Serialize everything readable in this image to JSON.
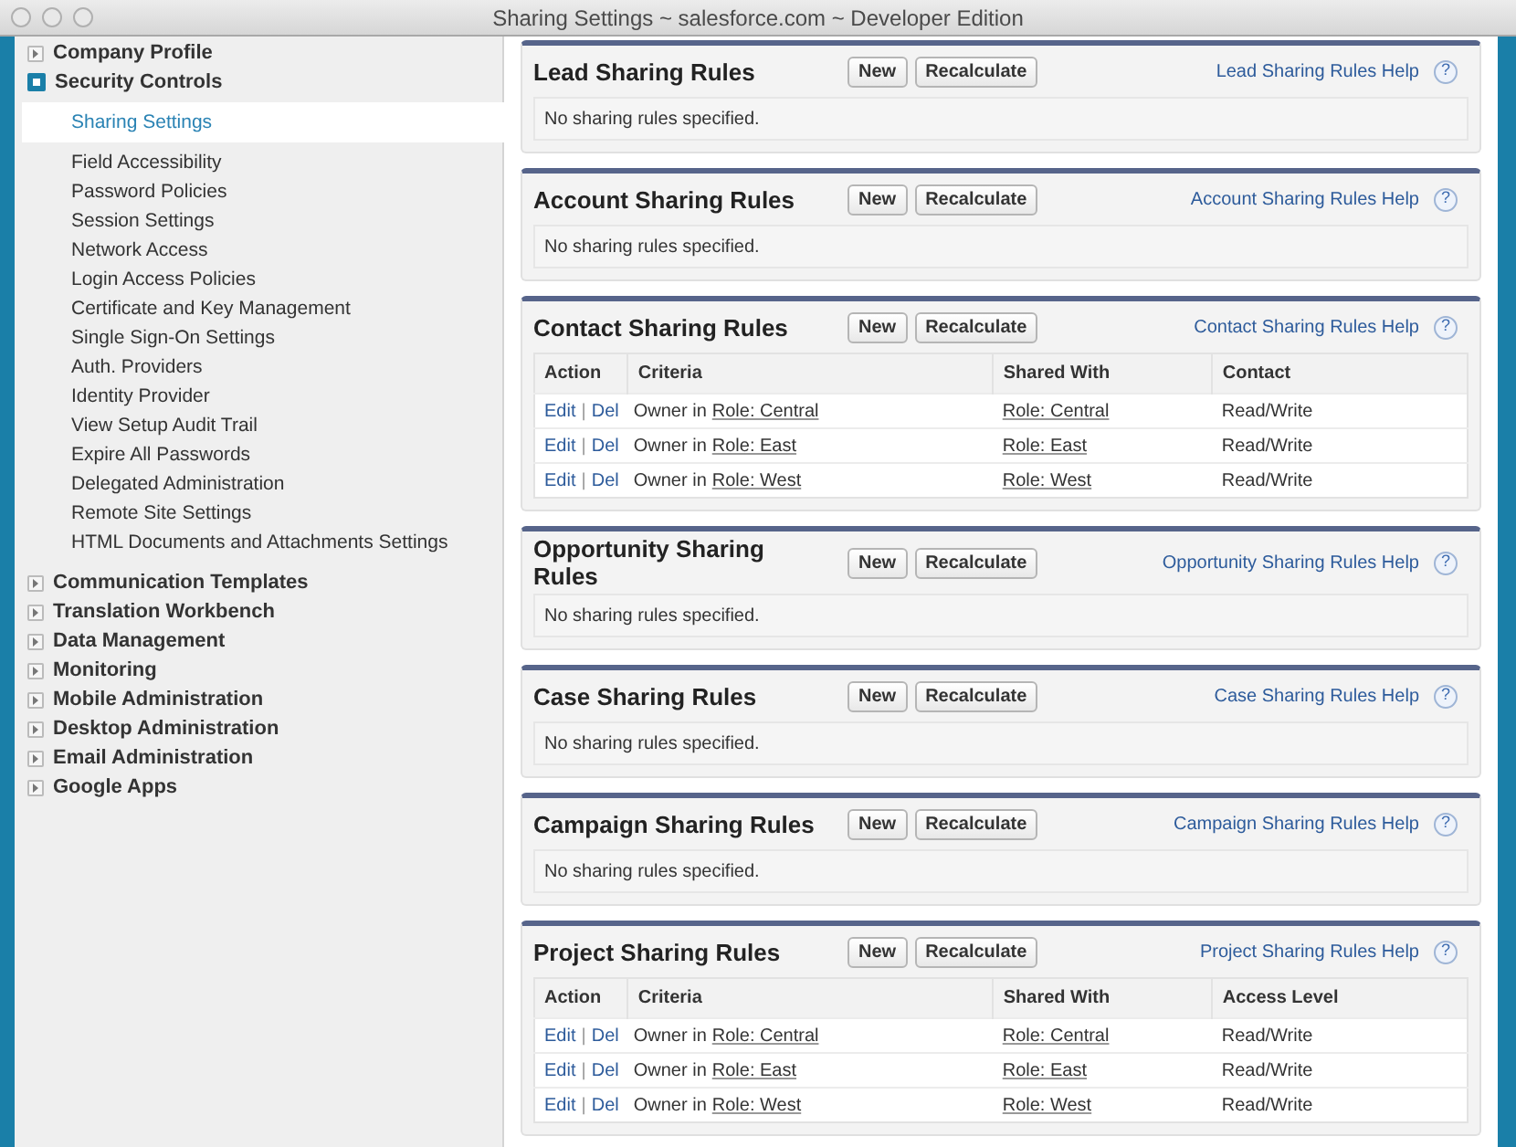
{
  "window": {
    "title": "Sharing Settings ~ salesforce.com ~ Developer Edition"
  },
  "sidebar": {
    "groups": [
      {
        "label": "Company Profile",
        "expanded": false
      },
      {
        "label": "Security Controls",
        "expanded": true,
        "children": [
          {
            "label": "Sharing Settings",
            "selected": true
          },
          {
            "label": "Field Accessibility",
            "selected": false
          },
          {
            "label": "Password Policies",
            "selected": false
          },
          {
            "label": "Session Settings",
            "selected": false
          },
          {
            "label": "Network Access",
            "selected": false
          },
          {
            "label": "Login Access Policies",
            "selected": false
          },
          {
            "label": "Certificate and Key Management",
            "selected": false
          },
          {
            "label": "Single Sign-On Settings",
            "selected": false
          },
          {
            "label": "Auth. Providers",
            "selected": false
          },
          {
            "label": "Identity Provider",
            "selected": false
          },
          {
            "label": "View Setup Audit Trail",
            "selected": false
          },
          {
            "label": "Expire All Passwords",
            "selected": false
          },
          {
            "label": "Delegated Administration",
            "selected": false
          },
          {
            "label": "Remote Site Settings",
            "selected": false
          },
          {
            "label": "HTML Documents and Attachments Settings",
            "selected": false
          }
        ]
      },
      {
        "label": "Communication Templates",
        "expanded": false
      },
      {
        "label": "Translation Workbench",
        "expanded": false
      },
      {
        "label": "Data Management",
        "expanded": false
      },
      {
        "label": "Monitoring",
        "expanded": false
      },
      {
        "label": "Mobile Administration",
        "expanded": false
      },
      {
        "label": "Desktop Administration",
        "expanded": false
      },
      {
        "label": "Email Administration",
        "expanded": false
      },
      {
        "label": "Google Apps",
        "expanded": false
      }
    ]
  },
  "sections": [
    {
      "title": "Lead Sharing Rules",
      "buttons": [
        "New",
        "Recalculate"
      ],
      "help": "Lead Sharing Rules Help",
      "help_icon": "?",
      "empty": "No sharing rules specified."
    },
    {
      "title": "Account Sharing Rules",
      "buttons": [
        "New",
        "Recalculate"
      ],
      "help": "Account Sharing Rules Help",
      "help_icon": "?",
      "empty": "No sharing rules specified."
    },
    {
      "title": "Contact Sharing Rules",
      "buttons": [
        "New",
        "Recalculate"
      ],
      "help": "Contact Sharing Rules Help",
      "help_icon": "?",
      "table": {
        "columns": [
          "Action",
          "Criteria",
          "Shared With",
          "Contact"
        ],
        "rows": [
          {
            "edit": "Edit",
            "separator": "|",
            "del": "Del",
            "criteria_prefix": "Owner in",
            "criteria_role": "Role: Central",
            "shared_with": "Role: Central",
            "access": "Read/Write"
          },
          {
            "edit": "Edit",
            "separator": "|",
            "del": "Del",
            "criteria_prefix": "Owner in",
            "criteria_role": "Role: East",
            "shared_with": "Role: East",
            "access": "Read/Write"
          },
          {
            "edit": "Edit",
            "separator": "|",
            "del": "Del",
            "criteria_prefix": "Owner in",
            "criteria_role": "Role: West",
            "shared_with": "Role: West",
            "access": "Read/Write"
          }
        ]
      }
    },
    {
      "title": "Opportunity Sharing Rules",
      "buttons": [
        "New",
        "Recalculate"
      ],
      "help": "Opportunity Sharing Rules Help",
      "help_icon": "?",
      "empty": "No sharing rules specified."
    },
    {
      "title": "Case Sharing Rules",
      "buttons": [
        "New",
        "Recalculate"
      ],
      "help": "Case Sharing Rules Help",
      "help_icon": "?",
      "empty": "No sharing rules specified."
    },
    {
      "title": "Campaign Sharing Rules",
      "buttons": [
        "New",
        "Recalculate"
      ],
      "help": "Campaign Sharing Rules Help",
      "help_icon": "?",
      "empty": "No sharing rules specified."
    },
    {
      "title": "Project Sharing Rules",
      "buttons": [
        "New",
        "Recalculate"
      ],
      "help": "Project Sharing Rules Help",
      "help_icon": "?",
      "table": {
        "columns": [
          "Action",
          "Criteria",
          "Shared With",
          "Access Level"
        ],
        "rows": [
          {
            "edit": "Edit",
            "separator": "|",
            "del": "Del",
            "criteria_prefix": "Owner in",
            "criteria_role": "Role: Central",
            "shared_with": "Role: Central",
            "access": "Read/Write"
          },
          {
            "edit": "Edit",
            "separator": "|",
            "del": "Del",
            "criteria_prefix": "Owner in",
            "criteria_role": "Role: East",
            "shared_with": "Role: East",
            "access": "Read/Write"
          },
          {
            "edit": "Edit",
            "separator": "|",
            "del": "Del",
            "criteria_prefix": "Owner in",
            "criteria_role": "Role: West",
            "shared_with": "Role: West",
            "access": "Read/Write"
          }
        ]
      }
    }
  ]
}
